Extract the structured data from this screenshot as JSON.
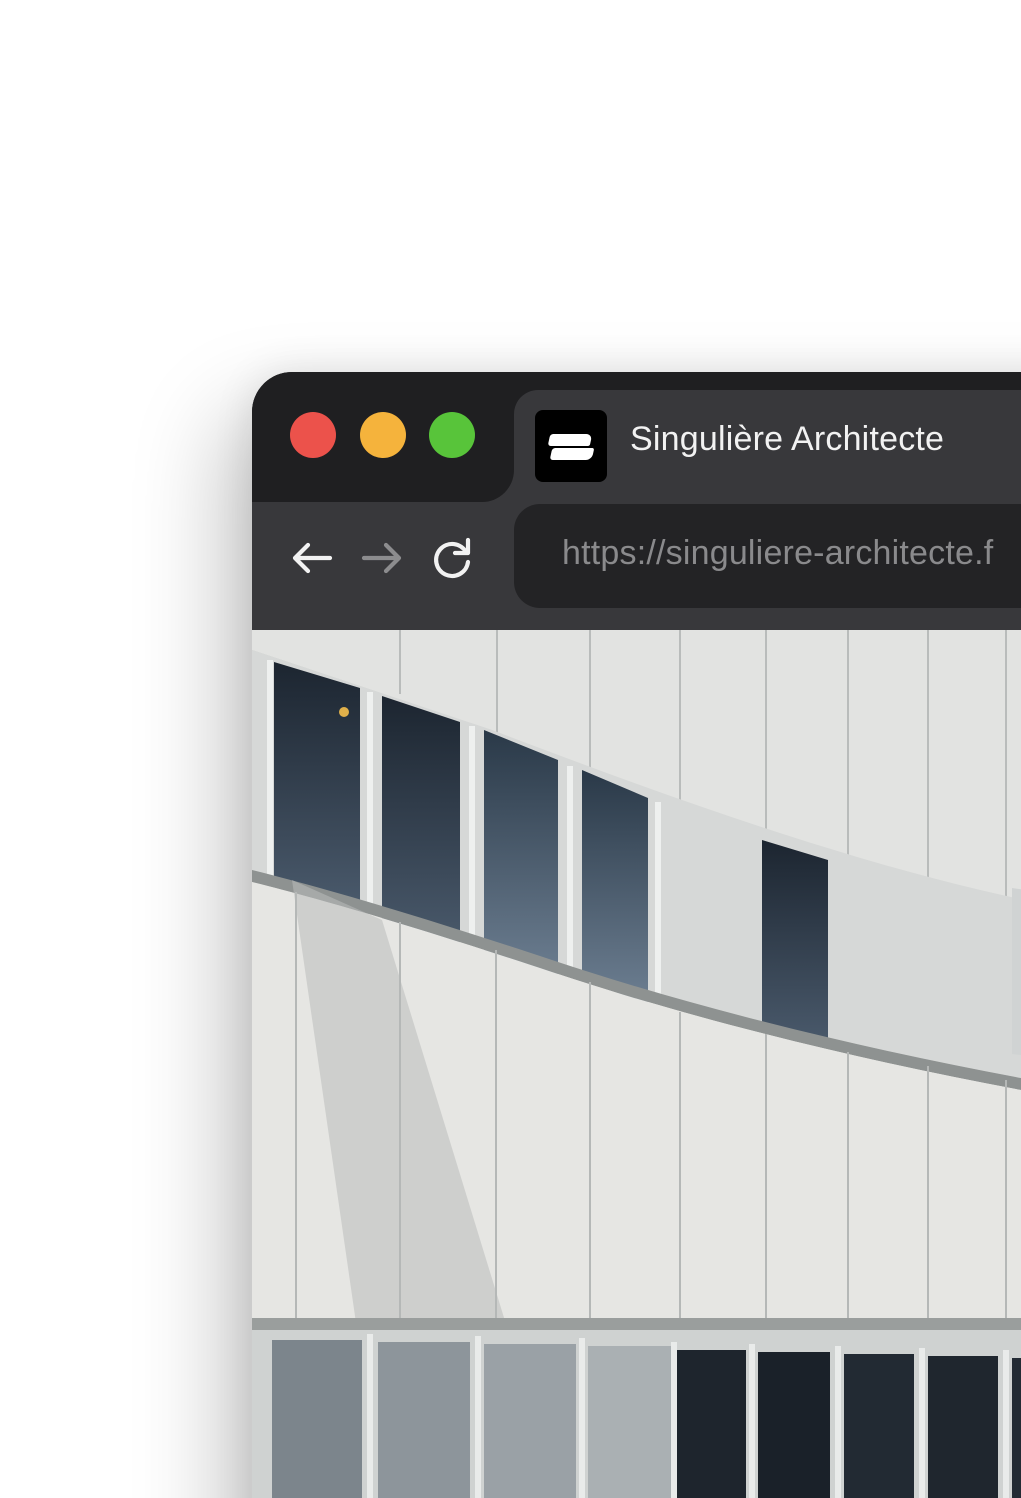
{
  "window": {
    "controls": {
      "close": {
        "icon": "close-traffic-light",
        "color": "#ec524b"
      },
      "minimize": {
        "icon": "minimize-traffic-light",
        "color": "#f5b33c"
      },
      "maximize": {
        "icon": "maximize-traffic-light",
        "color": "#58c43a"
      }
    }
  },
  "tab": {
    "title": "Singulière Architecte",
    "favicon": "singuliere-logo-icon"
  },
  "toolbar": {
    "back_icon": "arrow-left-icon",
    "forward_icon": "arrow-right-icon",
    "reload_icon": "reload-icon",
    "url": "https://singuliere-architecte.f"
  },
  "content": {
    "image": "curved-white-building-facade-photo"
  },
  "colors": {
    "titlebar": "#1f1f21",
    "tab": "#38383b",
    "urlbar": "#232325",
    "url_text": "#8a8a8c",
    "tab_text": "#f2f2f2"
  }
}
